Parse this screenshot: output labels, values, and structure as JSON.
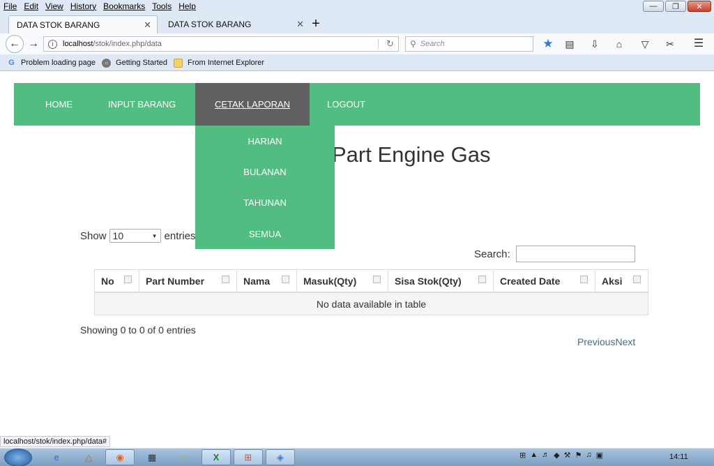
{
  "browser": {
    "menu": [
      "File",
      "Edit",
      "View",
      "History",
      "Bookmarks",
      "Tools",
      "Help"
    ],
    "tabs": [
      {
        "title": "DATA STOK BARANG",
        "active": true
      },
      {
        "title": "DATA STOK BARANG",
        "active": false
      }
    ],
    "new_tab_glyph": "+",
    "url_host": "localhost",
    "url_path": "/stok/index.php/data",
    "search_placeholder": "Search",
    "bookmarks": [
      {
        "label": "Problem loading page",
        "icon": "google-icon"
      },
      {
        "label": "Getting Started",
        "icon": "globe-icon"
      },
      {
        "label": "From Internet Explorer",
        "icon": "folder-icon"
      }
    ],
    "status_url": "localhost/stok/index.php/data#"
  },
  "site": {
    "nav": [
      "HOME",
      "INPUT BARANG",
      "CETAK LAPORAN",
      "LOGOUT"
    ],
    "active_nav": "CETAK LAPORAN",
    "dropdown": [
      "HARIAN",
      "BULANAN",
      "TAHUNAN",
      "SEMUA"
    ],
    "page_title": "Part Engine Gas",
    "show_label": "Show",
    "entries_value": "10",
    "entries_label": "entries",
    "search_label": "Search:",
    "search_value": "",
    "columns": [
      "No",
      "Part Number",
      "Nama",
      "Masuk(Qty)",
      "Sisa Stok(Qty)",
      "Created Date",
      "Aksi"
    ],
    "empty_text": "No data available in table",
    "info_text": "Showing 0 to 0 of 0 entries",
    "prev_label": "Previous",
    "next_label": "Next"
  },
  "taskbar": {
    "clock": "14:11"
  },
  "colors": {
    "nav_green": "#52bd80",
    "nav_active": "#606060"
  }
}
